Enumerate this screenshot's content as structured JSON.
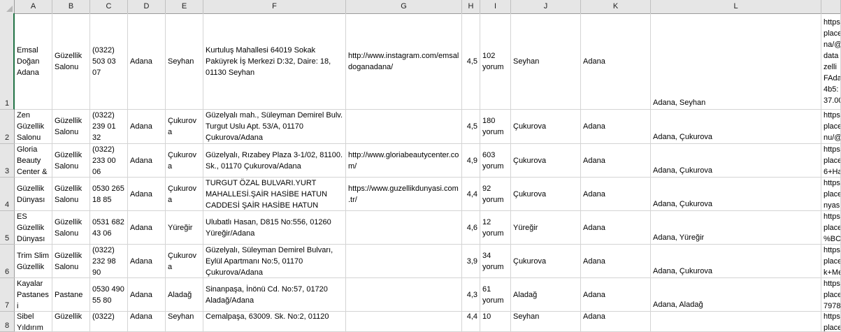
{
  "columns": [
    "A",
    "B",
    "C",
    "D",
    "E",
    "F",
    "G",
    "H",
    "I",
    "J",
    "K",
    "L"
  ],
  "rows": [
    {
      "num": "1",
      "cells": [
        "Emsal Doğan Adana",
        "Güzellik Salonu",
        "(0322) 503 03 07",
        "Adana",
        "Seyhan",
        "Kurtuluş Mahallesi 64019 Sokak Paküyrek İş Merkezi D:32, Daire: 18, 01130 Seyhan",
        "http://www.instagram.com/emsaldoganadana/",
        "4,5",
        "102 yorum",
        "Seyhan",
        "Adana",
        "Adana, Seyhan"
      ],
      "url": "https\nplace\nna/@\ndata\nzelli\nFAda\n4b5:\n37.00"
    },
    {
      "num": "2",
      "cells": [
        "Zen Güzellik Salonu",
        "Güzellik Salonu",
        "(0322) 239 01 32",
        "Adana",
        "Çukurova",
        "Güzelyalı mah., Süleyman Demirel Bulv. Turgut Uslu Apt. 53/A, 01170 Çukurova/Adana",
        "",
        "4,5",
        "180 yorum",
        "Çukurova",
        "Adana",
        "Adana, Çukurova"
      ],
      "url": "https\nplace\nnu/@"
    },
    {
      "num": "3",
      "cells": [
        "Gloria Beauty Center &",
        "Güzellik Salonu",
        "(0322) 233 00 06",
        "Adana",
        "Çukurova",
        "Güzelyalı, Rızabey Plaza 3-1/02, 81100. Sk., 01170 Çukurova/Adana",
        "http://www.gloriabeautycenter.com/",
        "4,9",
        "603 yorum",
        "Çukurova",
        "Adana",
        "Adana, Çukurova"
      ],
      "url": "https\nplace\n6+Ha"
    },
    {
      "num": "4",
      "cells": [
        "Güzellik Dünyası",
        "Güzellik Salonu",
        "0530 265 18 85",
        "Adana",
        "Çukurova",
        "TURGUT ÖZAL BULVARI.YURT MAHALLESİ.ŞAİR HASİBE HATUN CADDESİ ŞAİR HASİBE HATUN",
        "https://www.guzellikdunyasi.com.tr/",
        "4,4",
        "92 yorum",
        "Çukurova",
        "Adana",
        "Adana, Çukurova"
      ],
      "url": "https\nplace\nnyas"
    },
    {
      "num": "5",
      "cells": [
        "ES Güzellik Dünyası",
        "Güzellik Salonu",
        "0531 682 43 06",
        "Adana",
        "Yüreğir",
        "Ulubatlı Hasan, D815 No:556, 01260 Yüreğir/Adana",
        "",
        "4,6",
        "12 yorum",
        "Yüreğir",
        "Adana",
        "Adana, Yüreğir"
      ],
      "url": "https\nplace\n%BCr"
    },
    {
      "num": "6",
      "cells": [
        "Trim Slim Güzellik",
        "Güzellik Salonu",
        "(0322) 232 98 90",
        "Adana",
        "Çukurova",
        "Güzelyalı, Süleyman Demirel Bulvarı, Eylül Apartmanı No:5, 01170 Çukurova/Adana",
        "",
        "3,9",
        "34 yorum",
        "Çukurova",
        "Adana",
        "Adana, Çukurova"
      ],
      "url": "https\nplace\nk+Me"
    },
    {
      "num": "7",
      "cells": [
        "Kayalar Pastanesi",
        "Pastane",
        "0530 490 55 80",
        "Adana",
        "Aladağ",
        "Sinanpaşa, İnönü Cd. No:57, 01720 Aladağ/Adana",
        "",
        "4,3",
        "61 yorum",
        "Aladağ",
        "Adana",
        "Adana, Aladağ"
      ],
      "url": "https\nplace\n7978"
    },
    {
      "num": "8",
      "cells": [
        "Sibel Yıldırım",
        "Güzellik",
        "(0322)",
        "Adana",
        "Seyhan",
        "Cemalpaşa, 63009. Sk. No:2, 01120",
        "",
        "4,4",
        "10",
        "Seyhan",
        "Adana",
        ""
      ],
      "url": "https\nplace"
    }
  ],
  "colors": {
    "header_bg": "#e6e6e6",
    "grid_line": "#d4d4d4",
    "active_row": "#217346"
  }
}
